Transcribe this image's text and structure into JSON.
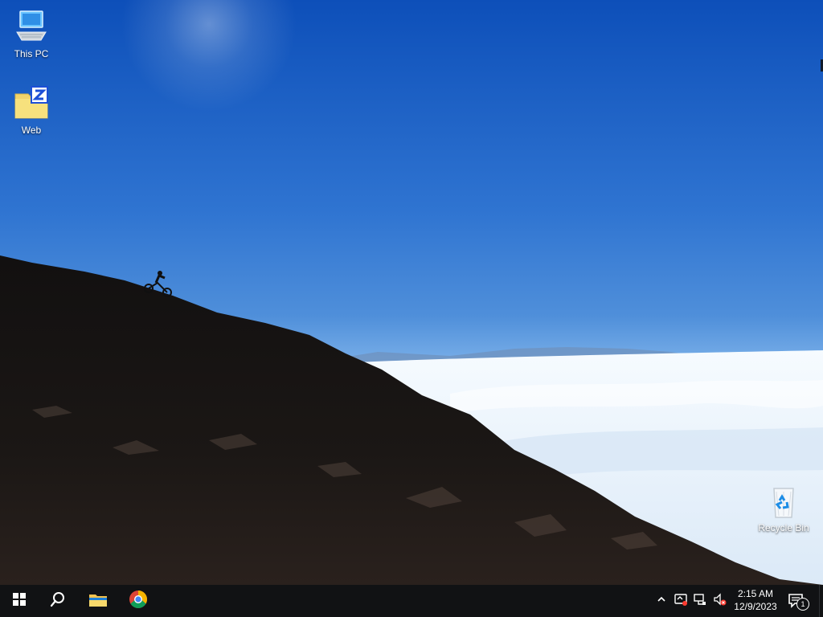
{
  "desktop": {
    "icons": [
      {
        "label": "This PC",
        "icon": "computer-icon"
      },
      {
        "label": "Web",
        "icon": "folder-z-icon"
      },
      {
        "label": "Recycle Bin",
        "icon": "recycle-bin-icon"
      }
    ]
  },
  "taskbar": {
    "buttons": [
      {
        "icon": "windows-start-icon"
      },
      {
        "icon": "search-icon"
      },
      {
        "icon": "file-explorer-icon"
      },
      {
        "icon": "chrome-icon"
      }
    ],
    "tray": {
      "icons": [
        {
          "icon": "chevron-up-icon"
        },
        {
          "icon": "security-alert-icon"
        },
        {
          "icon": "network-icon"
        },
        {
          "icon": "volume-muted-icon"
        }
      ],
      "clock": {
        "time": "2:15 AM",
        "date": "12/9/2023"
      },
      "notifications": {
        "icon": "notification-icon",
        "count": "1"
      }
    }
  },
  "colors": {
    "taskbar": "#111214",
    "sky_top": "#0d4fb9",
    "sky_mid": "#4f8fda",
    "clouds": "#e9f3ff"
  }
}
